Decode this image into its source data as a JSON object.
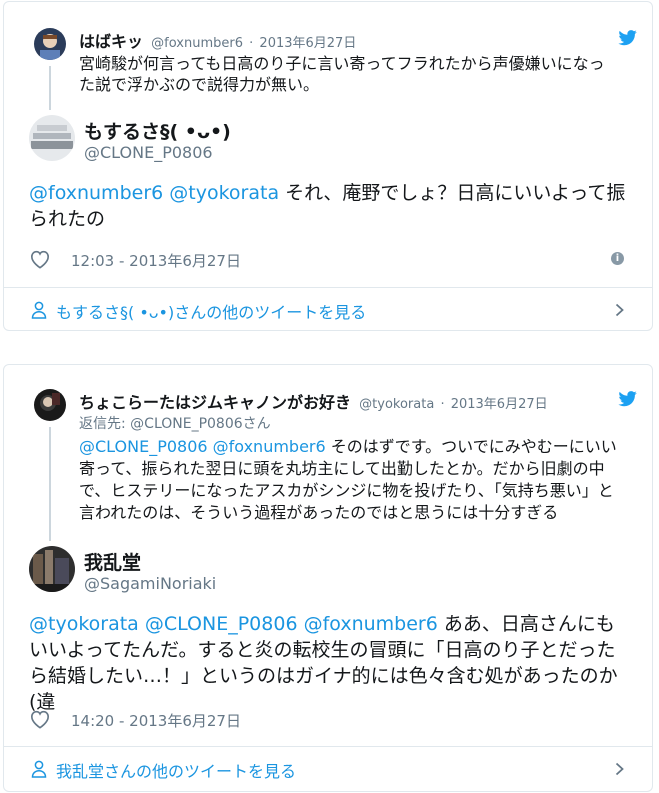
{
  "tweets": [
    {
      "parent": {
        "name": "はばキッ",
        "handle": "@foxnumber6",
        "sep": "·",
        "date": "2013年6月27日",
        "text": "宮崎駿が何言っても日高のり子に言い寄ってフラれたから声優嫌いになった説で浮かぶので説得力が無い。"
      },
      "main": {
        "name": "もするさ§( ︎•ᴗ•︎)",
        "handle": "@CLONE_P0806",
        "mentions": [
          "@foxnumber6",
          "@tyokorata"
        ],
        "text": "それ、庵野でしょ？日高にいいよって振られたの",
        "time": "12:03 - 2013年6月27日"
      },
      "more_label": "もするさ§( ︎•ᴗ•︎)さんの他のツイートを見る"
    },
    {
      "parent": {
        "name": "ちょこらーたはジムキャノンがお好き",
        "handle": "@tyokorata",
        "sep": "·",
        "date": "2013年6月27日",
        "reply_prefix": "返信先:",
        "reply_to": "@CLONE_P0806さん",
        "mentions": [
          "@CLONE_P0806",
          "@foxnumber6"
        ],
        "text": "そのはずです。ついでにみやむーにいい寄って、振られた翌日に頭を丸坊主にして出勤したとか。だから旧劇の中で、ヒステリーになったアスカがシンジに物を投げたり、「気持ち悪い」と言われたのは、そういう過程があったのではと思うには十分すぎる"
      },
      "main": {
        "name": "我乱堂",
        "handle": "@SagamiNoriaki",
        "mentions": [
          "@tyokorata",
          "@CLONE_P0806",
          "@foxnumber6"
        ],
        "text": "ああ、日高さんにもいいよってたんだ。すると炎の転校生の冒頭に「日高のり子とだったら結婚したい…！」というのはガイナ的には色々含む処があったのか(違",
        "time": "14:20 - 2013年6月27日"
      },
      "more_label": "我乱堂さんの他のツイートを見る"
    }
  ],
  "icons": {
    "bird": "twitter-bird-icon",
    "heart": "heart-icon",
    "info": "info-icon",
    "person": "person-icon",
    "chevron": "chevron-right-icon",
    "info_glyph": "i"
  },
  "colors": {
    "link": "#1b95e0",
    "secondary": "#657786",
    "border": "#e1e8ed",
    "text": "#14171a"
  }
}
